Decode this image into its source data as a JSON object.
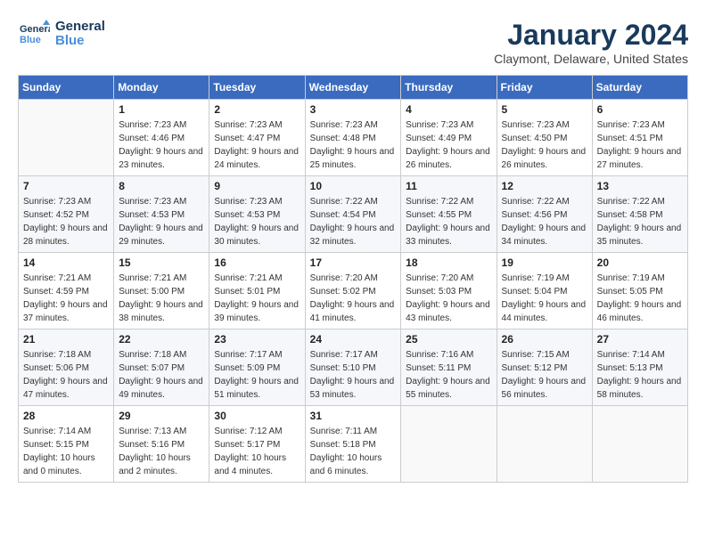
{
  "logo": {
    "line1": "General",
    "line2": "Blue"
  },
  "title": "January 2024",
  "subtitle": "Claymont, Delaware, United States",
  "weekdays": [
    "Sunday",
    "Monday",
    "Tuesday",
    "Wednesday",
    "Thursday",
    "Friday",
    "Saturday"
  ],
  "weeks": [
    [
      {
        "day": "",
        "sunrise": "",
        "sunset": "",
        "daylight": ""
      },
      {
        "day": "1",
        "sunrise": "Sunrise: 7:23 AM",
        "sunset": "Sunset: 4:46 PM",
        "daylight": "Daylight: 9 hours and 23 minutes."
      },
      {
        "day": "2",
        "sunrise": "Sunrise: 7:23 AM",
        "sunset": "Sunset: 4:47 PM",
        "daylight": "Daylight: 9 hours and 24 minutes."
      },
      {
        "day": "3",
        "sunrise": "Sunrise: 7:23 AM",
        "sunset": "Sunset: 4:48 PM",
        "daylight": "Daylight: 9 hours and 25 minutes."
      },
      {
        "day": "4",
        "sunrise": "Sunrise: 7:23 AM",
        "sunset": "Sunset: 4:49 PM",
        "daylight": "Daylight: 9 hours and 26 minutes."
      },
      {
        "day": "5",
        "sunrise": "Sunrise: 7:23 AM",
        "sunset": "Sunset: 4:50 PM",
        "daylight": "Daylight: 9 hours and 26 minutes."
      },
      {
        "day": "6",
        "sunrise": "Sunrise: 7:23 AM",
        "sunset": "Sunset: 4:51 PM",
        "daylight": "Daylight: 9 hours and 27 minutes."
      }
    ],
    [
      {
        "day": "7",
        "sunrise": "Sunrise: 7:23 AM",
        "sunset": "Sunset: 4:52 PM",
        "daylight": "Daylight: 9 hours and 28 minutes."
      },
      {
        "day": "8",
        "sunrise": "Sunrise: 7:23 AM",
        "sunset": "Sunset: 4:53 PM",
        "daylight": "Daylight: 9 hours and 29 minutes."
      },
      {
        "day": "9",
        "sunrise": "Sunrise: 7:23 AM",
        "sunset": "Sunset: 4:53 PM",
        "daylight": "Daylight: 9 hours and 30 minutes."
      },
      {
        "day": "10",
        "sunrise": "Sunrise: 7:22 AM",
        "sunset": "Sunset: 4:54 PM",
        "daylight": "Daylight: 9 hours and 32 minutes."
      },
      {
        "day": "11",
        "sunrise": "Sunrise: 7:22 AM",
        "sunset": "Sunset: 4:55 PM",
        "daylight": "Daylight: 9 hours and 33 minutes."
      },
      {
        "day": "12",
        "sunrise": "Sunrise: 7:22 AM",
        "sunset": "Sunset: 4:56 PM",
        "daylight": "Daylight: 9 hours and 34 minutes."
      },
      {
        "day": "13",
        "sunrise": "Sunrise: 7:22 AM",
        "sunset": "Sunset: 4:58 PM",
        "daylight": "Daylight: 9 hours and 35 minutes."
      }
    ],
    [
      {
        "day": "14",
        "sunrise": "Sunrise: 7:21 AM",
        "sunset": "Sunset: 4:59 PM",
        "daylight": "Daylight: 9 hours and 37 minutes."
      },
      {
        "day": "15",
        "sunrise": "Sunrise: 7:21 AM",
        "sunset": "Sunset: 5:00 PM",
        "daylight": "Daylight: 9 hours and 38 minutes."
      },
      {
        "day": "16",
        "sunrise": "Sunrise: 7:21 AM",
        "sunset": "Sunset: 5:01 PM",
        "daylight": "Daylight: 9 hours and 39 minutes."
      },
      {
        "day": "17",
        "sunrise": "Sunrise: 7:20 AM",
        "sunset": "Sunset: 5:02 PM",
        "daylight": "Daylight: 9 hours and 41 minutes."
      },
      {
        "day": "18",
        "sunrise": "Sunrise: 7:20 AM",
        "sunset": "Sunset: 5:03 PM",
        "daylight": "Daylight: 9 hours and 43 minutes."
      },
      {
        "day": "19",
        "sunrise": "Sunrise: 7:19 AM",
        "sunset": "Sunset: 5:04 PM",
        "daylight": "Daylight: 9 hours and 44 minutes."
      },
      {
        "day": "20",
        "sunrise": "Sunrise: 7:19 AM",
        "sunset": "Sunset: 5:05 PM",
        "daylight": "Daylight: 9 hours and 46 minutes."
      }
    ],
    [
      {
        "day": "21",
        "sunrise": "Sunrise: 7:18 AM",
        "sunset": "Sunset: 5:06 PM",
        "daylight": "Daylight: 9 hours and 47 minutes."
      },
      {
        "day": "22",
        "sunrise": "Sunrise: 7:18 AM",
        "sunset": "Sunset: 5:07 PM",
        "daylight": "Daylight: 9 hours and 49 minutes."
      },
      {
        "day": "23",
        "sunrise": "Sunrise: 7:17 AM",
        "sunset": "Sunset: 5:09 PM",
        "daylight": "Daylight: 9 hours and 51 minutes."
      },
      {
        "day": "24",
        "sunrise": "Sunrise: 7:17 AM",
        "sunset": "Sunset: 5:10 PM",
        "daylight": "Daylight: 9 hours and 53 minutes."
      },
      {
        "day": "25",
        "sunrise": "Sunrise: 7:16 AM",
        "sunset": "Sunset: 5:11 PM",
        "daylight": "Daylight: 9 hours and 55 minutes."
      },
      {
        "day": "26",
        "sunrise": "Sunrise: 7:15 AM",
        "sunset": "Sunset: 5:12 PM",
        "daylight": "Daylight: 9 hours and 56 minutes."
      },
      {
        "day": "27",
        "sunrise": "Sunrise: 7:14 AM",
        "sunset": "Sunset: 5:13 PM",
        "daylight": "Daylight: 9 hours and 58 minutes."
      }
    ],
    [
      {
        "day": "28",
        "sunrise": "Sunrise: 7:14 AM",
        "sunset": "Sunset: 5:15 PM",
        "daylight": "Daylight: 10 hours and 0 minutes."
      },
      {
        "day": "29",
        "sunrise": "Sunrise: 7:13 AM",
        "sunset": "Sunset: 5:16 PM",
        "daylight": "Daylight: 10 hours and 2 minutes."
      },
      {
        "day": "30",
        "sunrise": "Sunrise: 7:12 AM",
        "sunset": "Sunset: 5:17 PM",
        "daylight": "Daylight: 10 hours and 4 minutes."
      },
      {
        "day": "31",
        "sunrise": "Sunrise: 7:11 AM",
        "sunset": "Sunset: 5:18 PM",
        "daylight": "Daylight: 10 hours and 6 minutes."
      },
      {
        "day": "",
        "sunrise": "",
        "sunset": "",
        "daylight": ""
      },
      {
        "day": "",
        "sunrise": "",
        "sunset": "",
        "daylight": ""
      },
      {
        "day": "",
        "sunrise": "",
        "sunset": "",
        "daylight": ""
      }
    ]
  ]
}
